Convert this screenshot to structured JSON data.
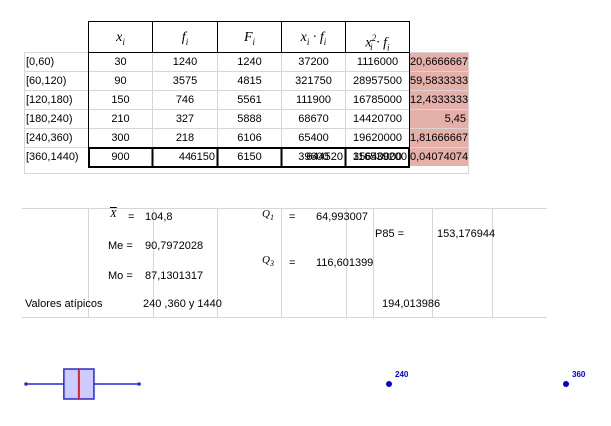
{
  "table": {
    "headers": [
      {
        "main": "x",
        "sub": "i",
        "sup": ""
      },
      {
        "main": "f",
        "sub": "i",
        "sup": ""
      },
      {
        "main": "F",
        "sub": "i",
        "sup": ""
      },
      {
        "main": "x",
        "sub": "i",
        "sup": "",
        "mid": "· f",
        "sub2": "i"
      },
      {
        "main": "x",
        "sub": "i",
        "sup": "2",
        "mid": "· f",
        "sub2": "i"
      }
    ],
    "rows": [
      {
        "interval": "[0,60)",
        "x": "30",
        "f": "1240",
        "F": "1240",
        "xf": "37200",
        "x2f": "1116000",
        "extra": "20,6666667"
      },
      {
        "interval": "[60,120)",
        "x": "90",
        "f": "3575",
        "F": "4815",
        "xf": "321750",
        "x2f": "28957500",
        "extra": "59,5833333"
      },
      {
        "interval": "[120,180)",
        "x": "150",
        "f": "746",
        "F": "5561",
        "xf": "111900",
        "x2f": "16785000",
        "extra": "12,4333333"
      },
      {
        "interval": "[180,240)",
        "x": "210",
        "f": "327",
        "F": "5888",
        "xf": "68670",
        "x2f": "14420700",
        "extra": "5,45"
      },
      {
        "interval": "[240,360)",
        "x": "300",
        "f": "218",
        "F": "6106",
        "xf": "65400",
        "x2f": "19620000",
        "extra": "1,81666667"
      },
      {
        "interval": "[360,1440)",
        "x": "900",
        "f": "44",
        "F": "6150",
        "xf": "39600",
        "x2f": "35640000",
        "extra": "0,04074074"
      }
    ],
    "totals": {
      "f": "6150",
      "xf": "644520",
      "x2f": "116539200"
    }
  },
  "stats": {
    "mean_symbol": "X",
    "mean_eq": "=",
    "mean_value": "104,8",
    "me_label": "Me  =",
    "me_value": "90,7972028",
    "mo_label": "Mo  =",
    "mo_value": "87,1301317",
    "q1_symbol": "Q",
    "q1_sub": "1",
    "q1_eq": "=",
    "q1_value": "64,993007",
    "q3_symbol": "Q",
    "q3_sub": "3",
    "q3_eq": "=",
    "q3_value": "116,601399",
    "p85_label": "P85  =",
    "p85_value": "153,176944",
    "outliers_label": "Valores atípicos",
    "outliers_value": "240 ,360 y 1440",
    "fence_value": "194,013986"
  },
  "boxplot": {
    "whisker_low": 0,
    "q1": 64.993007,
    "median": 90.7972028,
    "q3": 116.601399,
    "whisker_high": 194.013986,
    "outliers": [
      {
        "value": 240,
        "label": "240"
      },
      {
        "value": 360,
        "label": "360"
      }
    ],
    "box_fill": "#ccccff",
    "box_stroke": "#2a2ad4",
    "median_color": "#e02020",
    "point_color": "#0000cc"
  }
}
